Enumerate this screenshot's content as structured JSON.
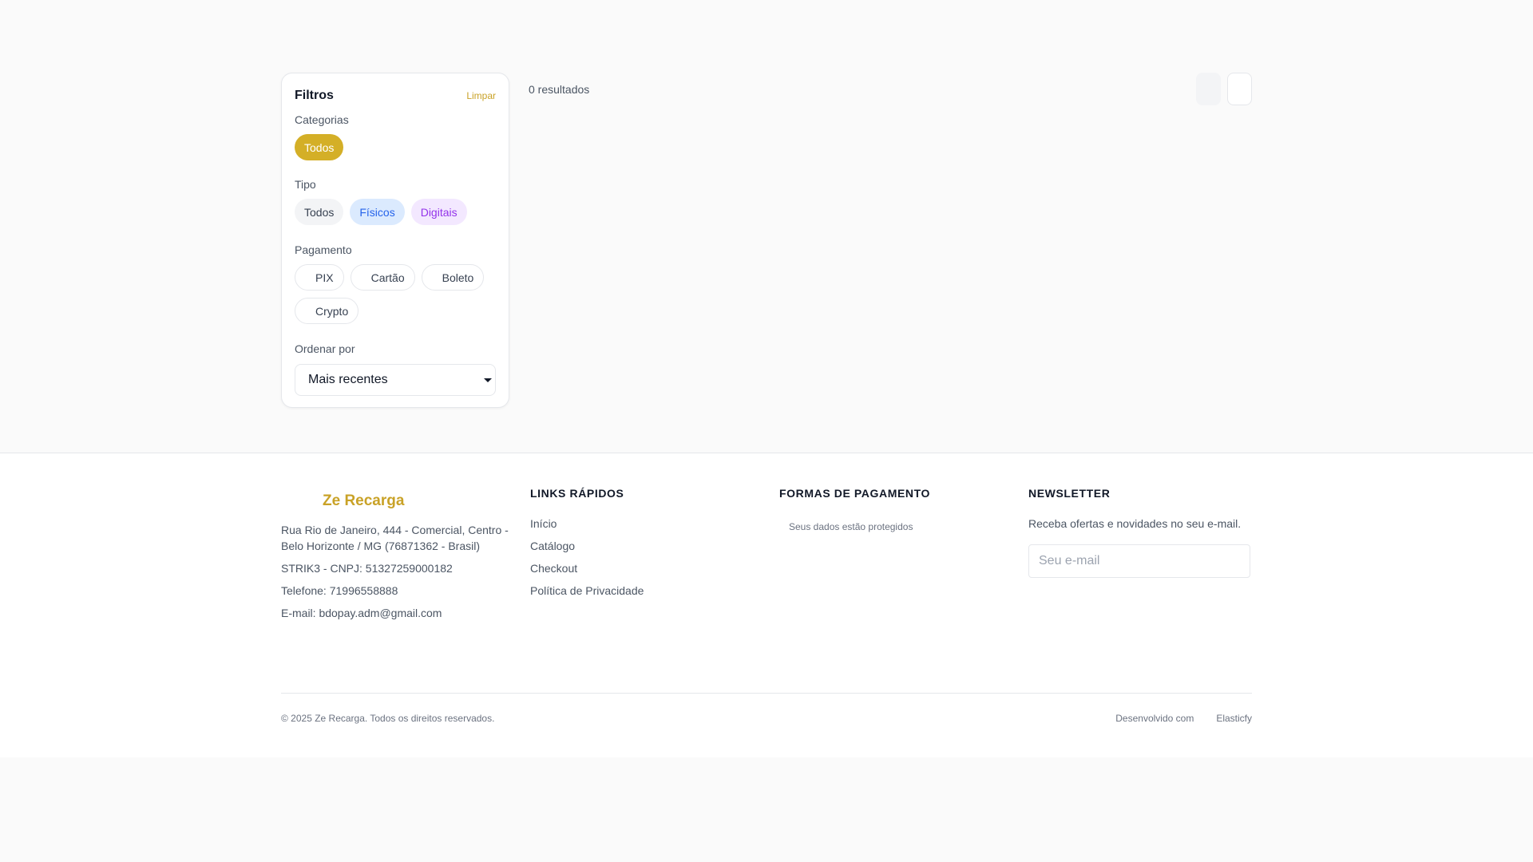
{
  "filters": {
    "title": "Filtros",
    "clear_label": "Limpar",
    "categories": {
      "label": "Categorias",
      "options": [
        "Todos"
      ],
      "selected": "Todos"
    },
    "type": {
      "label": "Tipo",
      "options": [
        "Todos",
        "Físicos",
        "Digitais"
      ]
    },
    "payment": {
      "label": "Pagamento",
      "options": [
        "PIX",
        "Cartão",
        "Boleto",
        "Crypto"
      ]
    },
    "sort": {
      "label": "Ordenar por",
      "value": "Mais recentes"
    }
  },
  "results": {
    "count_text": "0 resultados"
  },
  "colors": {
    "accent": "#d4af27",
    "brand_text": "#c9a227"
  },
  "footer": {
    "brand": {
      "name": "Ze Recarga",
      "address": "Rua Rio de Janeiro, 444 - Comercial, Centro - Belo Horizonte / MG (76871362 - Brasil)",
      "company": "STRIK3 - CNPJ: 51327259000182",
      "phone": "Telefone: 71996558888",
      "email": "E-mail: bdopay.adm@gmail.com"
    },
    "quick_links": {
      "title": "LINKS RÁPIDOS",
      "items": [
        "Início",
        "Catálogo",
        "Checkout",
        "Política de Privacidade"
      ]
    },
    "payment_methods": {
      "title": "FORMAS DE PAGAMENTO",
      "secure_text": "Seus dados estão protegidos"
    },
    "newsletter": {
      "title": "NEWSLETTER",
      "text": "Receba ofertas e novidades no seu e-mail.",
      "placeholder": "Seu e-mail"
    },
    "copyright": "© 2025 Ze Recarga. Todos os direitos reservados.",
    "developed_with": "Desenvolvido com",
    "developer": "Elasticfy"
  }
}
